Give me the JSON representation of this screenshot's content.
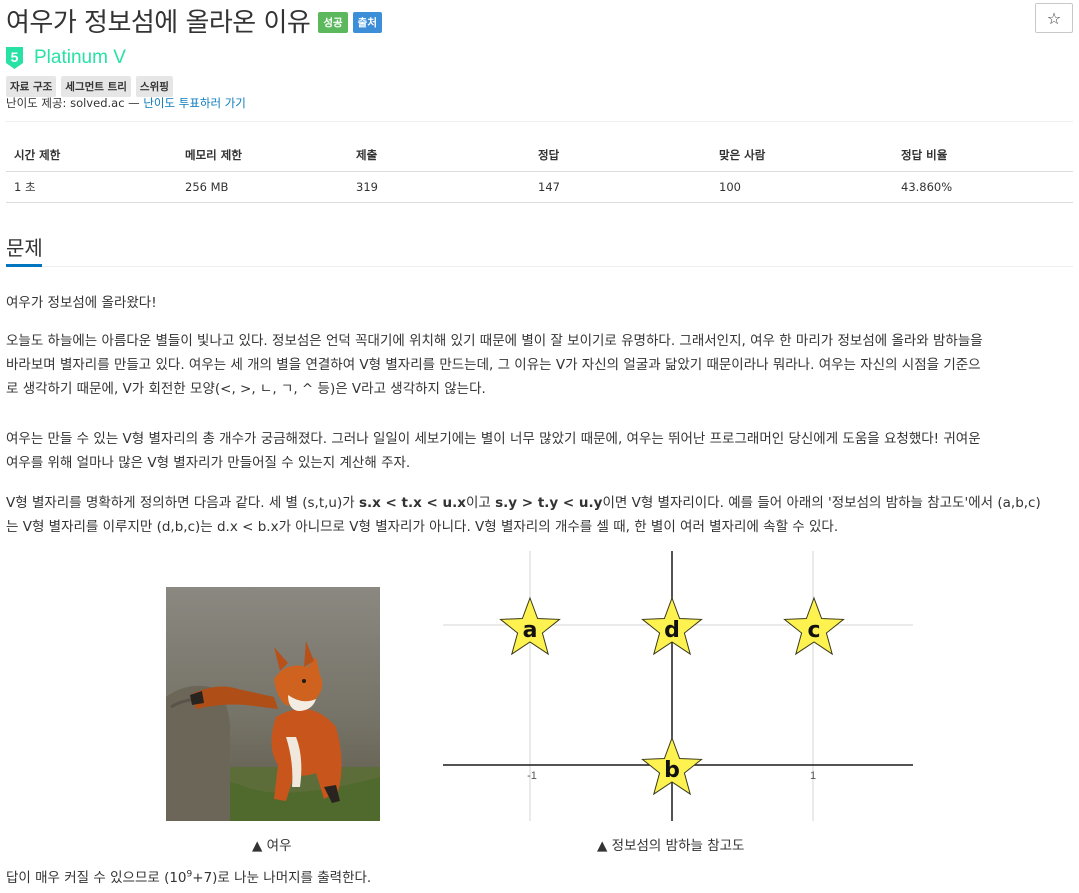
{
  "problem": {
    "title": "여우가 정보섬에 올라온 이유",
    "labels": {
      "success": "성공",
      "source": "출처"
    },
    "star_icon": "☆"
  },
  "tier": {
    "number": "5",
    "text": "Platinum V",
    "color": "#27e2a4"
  },
  "tags": [
    "자료 구조",
    "세그먼트 트리",
    "스위핑"
  ],
  "credit": {
    "prefix": "난이도 제공: solved.ac — ",
    "link": "난이도 투표하러 가기"
  },
  "info_table": {
    "headers": [
      "시간 제한",
      "메모리 제한",
      "제출",
      "정답",
      "맞은 사람",
      "정답 비율"
    ],
    "values": [
      "1 초",
      "256 MB",
      "319",
      "147",
      "100",
      "43.860%"
    ]
  },
  "section": {
    "title": "문제"
  },
  "paragraphs": {
    "p1": "여우가 정보섬에 올라왔다!",
    "p2_line1": "오늘도 하늘에는 아름다운 별들이 빛나고 있다. 정보섬은 언덕 꼭대기에 위치해 있기 때문에 별이 잘 보이기로 유명하다. 그래서인지, 여우 한 마리가 정보섬에 올라와 밤하늘을",
    "p2_line2": "바라보며 별자리를 만들고 있다. 여우는 세 개의 별을 연결하여 V형 별자리를 만드는데, 그 이유는 V가 자신의 얼굴과 닮았기 때문이라나 뭐라나. 여우는 자신의 시점을 기준으",
    "p2_line3": "로 생각하기 때문에, V가 회전한 모양(<, >, ㄴ, ㄱ, ^ 등)은 V라고 생각하지 않는다.",
    "p3_line1": "여우는 만들 수 있는 V형 별자리의 총 개수가 궁금해졌다. 그러나 일일이 세보기에는 별이 너무 많았기 때문에, 여우는 뛰어난 프로그래머인 당신에게 도움을 요청했다! 귀여운",
    "p3_line2": "여우를 위해 얼마나 많은 V형 별자리가 만들어질 수 있는지 계산해 주자.",
    "p4_a": "V형 별자리를 명확하게 정의하면 다음과 같다. 세 별 (s,t,u)가 ",
    "p4_b1": "s.x < t.x < u.x",
    "p4_c": "이고 ",
    "p4_b2": "s.y > t.y < u.y",
    "p4_d": "이면 V형 별자리이다. 예를 들어 아래의 '정보섬의 밤하늘 참고도'에서 (a,b,c)",
    "p4_line2": "는 V형 별자리를 이루지만 (d,b,c)는 d.x < b.x가 아니므로 V형 별자리가 아니다. V형 별자리의 개수를 셀 때, 한 별이 여러 별자리에 속할 수 있다.",
    "footer_a": "답이 매우 커질 수 있으므로 (10",
    "footer_sup": "9",
    "footer_b": "+7)로 나눈 나머지를 출력한다."
  },
  "figures": {
    "fox_caption": "▲ 여우",
    "diagram_caption": "▲ 정보섬의 밤하늘 참고도",
    "diagram": {
      "stars": [
        {
          "label": "a",
          "x": -1,
          "y": 1
        },
        {
          "label": "d",
          "x": 0,
          "y": 1
        },
        {
          "label": "c",
          "x": 1,
          "y": 1
        },
        {
          "label": "b",
          "x": 0,
          "y": 0
        }
      ],
      "x_ticks": [
        "-1",
        "0",
        "1"
      ],
      "y_ticks": [
        "1",
        "0"
      ],
      "star_color": "#fdf24f"
    }
  }
}
